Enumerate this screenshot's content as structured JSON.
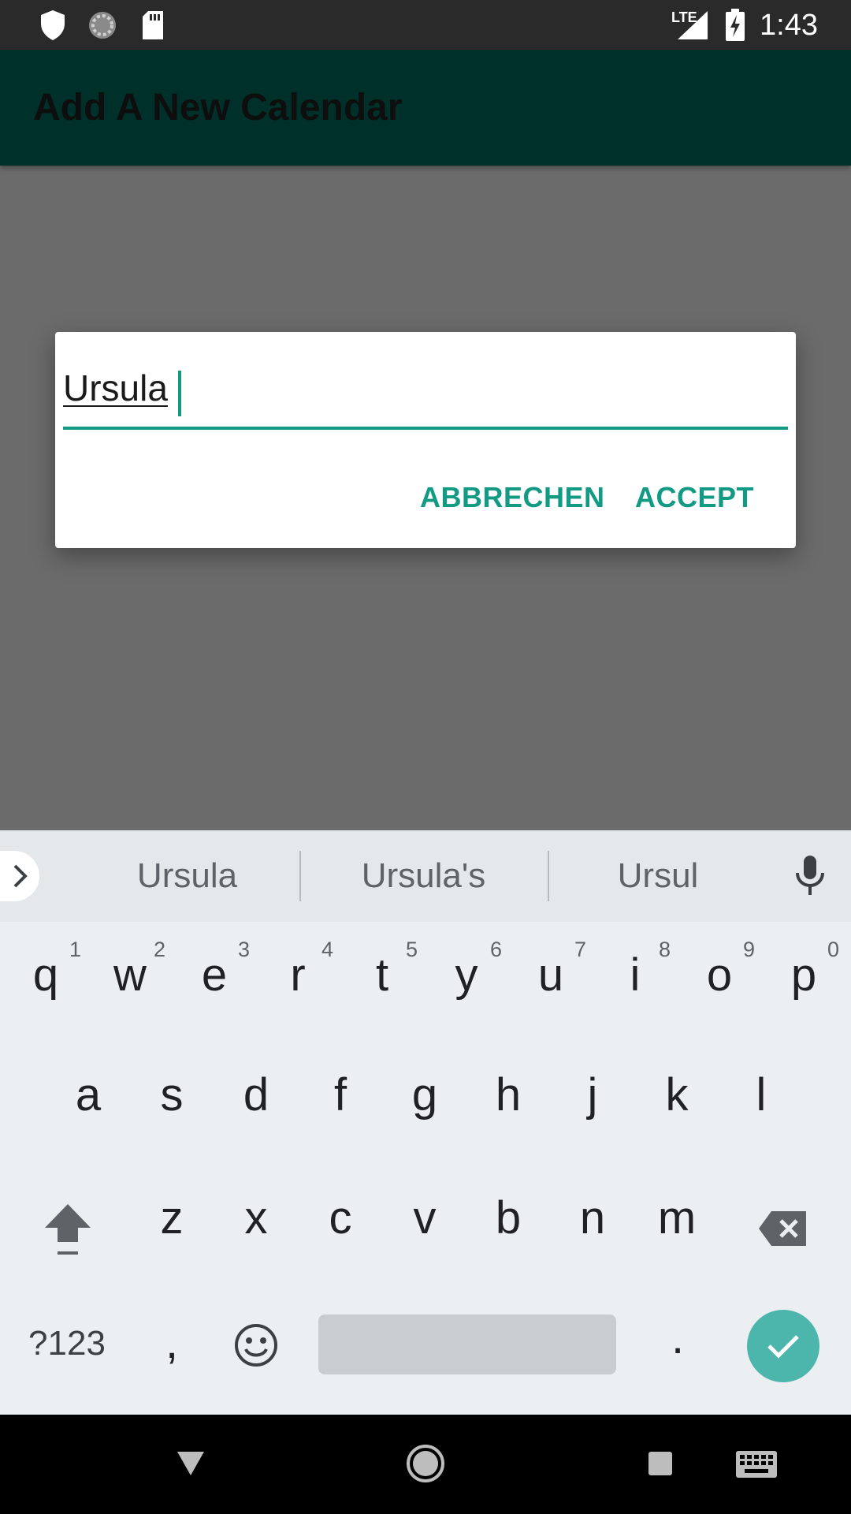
{
  "status_bar": {
    "time": "1:43",
    "network_label": "LTE",
    "icons": [
      "shield-icon",
      "sync-icon",
      "sd-card-icon",
      "signal-icon",
      "battery-charging-icon"
    ]
  },
  "app_bar": {
    "title": "Add A New Calendar"
  },
  "dialog": {
    "input_value": "Ursula",
    "cancel_label": "ABBRECHEN",
    "accept_label": "ACCEPT",
    "accent_color": "#129a84"
  },
  "keyboard": {
    "suggestions": [
      "Ursula",
      "Ursula's",
      "Ursul"
    ],
    "row1": [
      "q",
      "w",
      "e",
      "r",
      "t",
      "y",
      "u",
      "i",
      "o",
      "p"
    ],
    "row1_hints": [
      "1",
      "2",
      "3",
      "4",
      "5",
      "6",
      "7",
      "8",
      "9",
      "0"
    ],
    "row2": [
      "a",
      "s",
      "d",
      "f",
      "g",
      "h",
      "j",
      "k",
      "l"
    ],
    "row3": [
      "z",
      "x",
      "c",
      "v",
      "b",
      "n",
      "m"
    ],
    "symbols_label": "?123",
    "comma_label": ",",
    "period_label": "."
  },
  "nav_bar": {
    "icons": [
      "back-icon",
      "home-icon",
      "recents-icon",
      "keyboard-icon"
    ]
  }
}
